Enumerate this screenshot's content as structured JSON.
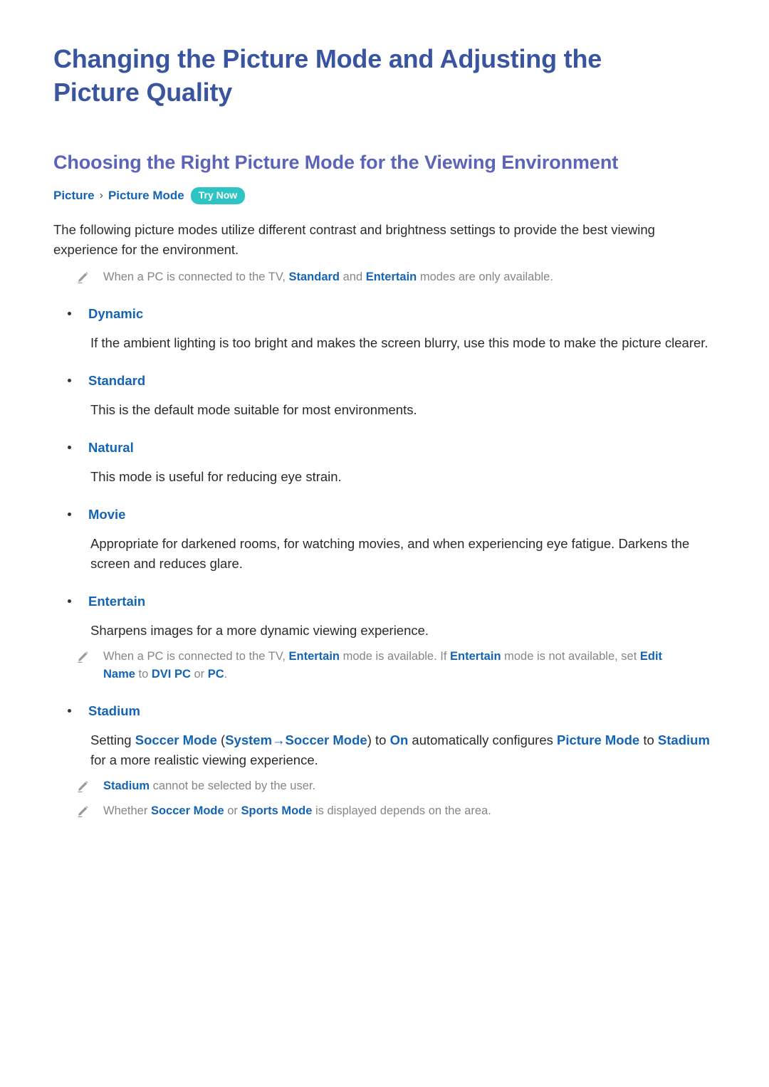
{
  "document": {
    "title": "Changing the Picture Mode and Adjusting the Picture Quality",
    "section_title": "Choosing the Right Picture Mode for the Viewing Environment"
  },
  "breadcrumb": {
    "root": "Picture",
    "separator": "›",
    "leaf": "Picture Mode",
    "badge": "Try Now"
  },
  "intro": {
    "paragraph": "The following picture modes utilize different contrast and brightness settings to provide the best viewing experience for the environment.",
    "note": {
      "icon": "pencil-icon",
      "part1": "When a PC is connected to the TV, ",
      "term1": "Standard",
      "part2": " and ",
      "term2": "Entertain",
      "part3": " modes are only available."
    }
  },
  "modes": [
    {
      "label": "Dynamic",
      "description": "If the ambient lighting is too bright and makes the screen blurry, use this mode to make the picture clearer."
    },
    {
      "label": "Standard",
      "description": "This is the default mode suitable for most environments."
    },
    {
      "label": "Natural",
      "description": "This mode is useful for reducing eye strain."
    },
    {
      "label": "Movie",
      "description": "Appropriate for darkened rooms, for watching movies, and when experiencing eye fatigue. Darkens the screen and reduces glare."
    },
    {
      "label": "Entertain",
      "description": "Sharpens images for a more dynamic viewing experience."
    },
    {
      "label": "Stadium",
      "description": ""
    }
  ],
  "entertain_note": {
    "icon": "pencil-icon",
    "part1": "When a PC is connected to the TV, ",
    "term1": "Entertain",
    "part2": " mode is available. If ",
    "term2": "Entertain",
    "part3": " mode is not available, set ",
    "term3": "Edit Name",
    "part4": " to ",
    "term4": "DVI PC",
    "part5": " or ",
    "term5": "PC",
    "part6": "."
  },
  "stadium": {
    "paragraph": {
      "part1": "Setting ",
      "term1": "Soccer Mode",
      "part2": " (",
      "term2": "System",
      "arrow": "→",
      "term3": "Soccer Mode",
      "part3": ") to ",
      "term4": "On",
      "part4": " automatically configures ",
      "term5": "Picture Mode",
      "part5": " to ",
      "term6": "Stadium",
      "part6": " for a more realistic viewing experience."
    },
    "note1": {
      "icon": "pencil-icon",
      "term1": "Stadium",
      "part1": " cannot be selected by the user."
    },
    "note2": {
      "icon": "pencil-icon",
      "part1": "Whether ",
      "term1": "Soccer Mode",
      "part2": " or ",
      "term2": "Sports Mode",
      "part3": " is displayed depends on the area."
    }
  },
  "colors": {
    "doc_title": "#3a55a0",
    "section_title": "#5b64b8",
    "link_blue": "#1464b4",
    "badge_teal": "#2ec4c4",
    "body": "#2b2b2b",
    "note_gray": "#868686"
  }
}
